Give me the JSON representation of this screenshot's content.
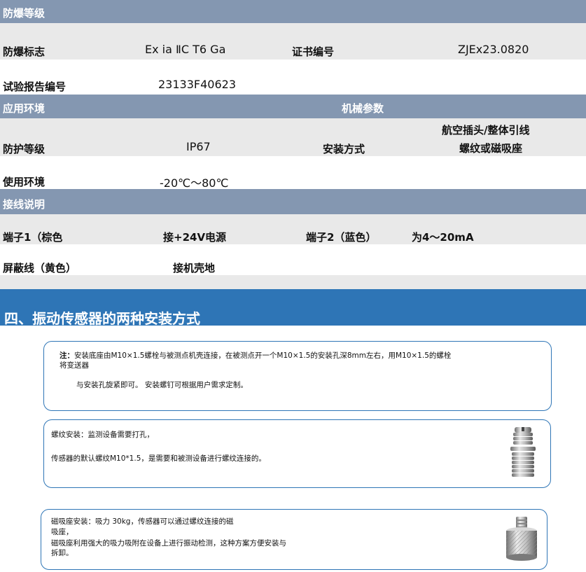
{
  "explosion": {
    "header": "防爆等级",
    "mark_label": "防爆标志",
    "mark_value": "Ex ia ⅡC T6 Ga",
    "cert_label": "证书编号",
    "cert_value": "ZJEx23.0820",
    "report_label": "试验报告编号",
    "report_value": "23133F40623"
  },
  "environment": {
    "header_left": "应用环境",
    "header_right": "机械参数",
    "protection_label": "防护等级",
    "protection_value": "IP67",
    "mount_label": "安装方式",
    "mount_value_line1": "航空插头/整体引线",
    "mount_value_line2": "螺纹或磁吸座",
    "usage_label": "使用环境",
    "usage_value": "-20℃～80℃"
  },
  "wiring": {
    "header": "接线说明",
    "t1_label": "端子1（棕色",
    "t1_value": "接+24V电源",
    "t2_label": "端子2（蓝色）",
    "t2_value": "为4～20mA",
    "shield_label": "屏蔽线（黄色）",
    "shield_value": "接机壳地"
  },
  "section_title": "四、振动传感器的两种安装方式",
  "note_box": {
    "prefix": "注：",
    "line1": "安装底座由M10×1.5螺栓与被测点机壳连接，在被测点开一个M10×1.5的安装孔深8mm左右，用M10×1.5的螺栓",
    "line2": "将变送器",
    "line3": "与安装孔旋紧即可。 安装螺钉可根据用户需求定制。"
  },
  "thread_box": {
    "line1": "螺纹安装：监测设备需要打孔，",
    "line2": "传感器的默认螺纹M10*1.5，是需要和被测设备进行螺纹连接的。"
  },
  "magnet_box": {
    "line1": "磁吸座安装：吸力 30kg，传感器可以通过螺纹连接的磁",
    "line2": "吸座，",
    "line3": "磁吸座利用强大的吸力吸附在设备上进行振动检测，这种方案方便安装与",
    "line4": "拆卸。"
  },
  "colors": {
    "header_band": "#8497b1",
    "title_band": "#2e75b6",
    "grey_row": "#e9e9e9",
    "box_border": "#2e75b6"
  }
}
